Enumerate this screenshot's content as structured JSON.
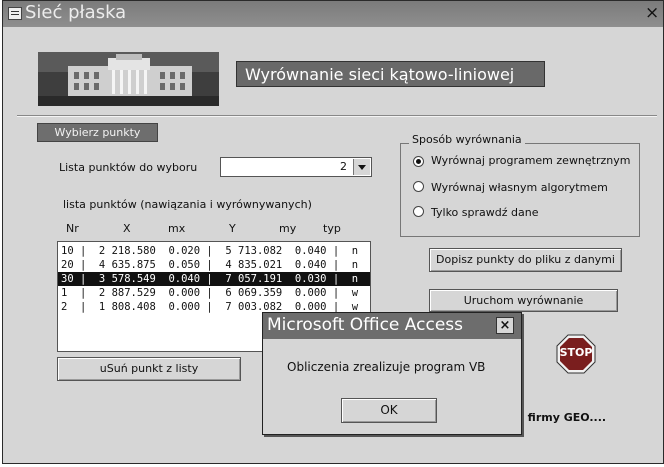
{
  "window": {
    "title": "Sieć płaska",
    "close_glyph": "×",
    "heading": "Wyrównanie sieci kątowo-liniowej"
  },
  "left": {
    "select_button_label": "Wybierz punkty",
    "combo_label": "Lista punktów do wyboru",
    "combo_value": "2",
    "list_caption": "lista punktów (nawiązania i wyrównywanych)",
    "columns": [
      "Nr",
      "X",
      "mx",
      "Y",
      "my",
      "typ"
    ],
    "rows": [
      "10 |  2 218.580  0.020 |  5 713.082  0.040 |  n",
      "20 |  4 635.875  0.050 |  4 835.021  0.040 |  n",
      "30 |  3 578.549  0.040 |  7 057.191  0.030 |  n",
      "1  |  2 887.529  0.000 |  6 069.359  0.000 |  w",
      "2  |  1 808.408  0.000 |  7 003.082  0.000 |  w"
    ],
    "selected_row_index": 2,
    "remove_button_label": "uSuń punkt z listy"
  },
  "right": {
    "group_title": "Sposób wyrównania",
    "options": [
      {
        "label": "Wyrównaj programem zewnętrznym",
        "checked": true
      },
      {
        "label": "Wyrównaj własnym algorytmem",
        "checked": false
      },
      {
        "label": "Tylko sprawdź dane",
        "checked": false
      }
    ],
    "append_button_label": "Dopisz punkty do pliku z danymi",
    "run_button_label": "Uruchom wyrównanie",
    "stop_label": "STOP",
    "footer_text": "h firmy GEO...."
  },
  "dialog": {
    "title": "Microsoft Office Access",
    "close_glyph": "×",
    "message": "Obliczenia zrealizuje program VB",
    "ok_label": "OK"
  },
  "colors": {
    "window_bg": "#d6d6d6",
    "title_bar": "#858585",
    "heading_bg": "#696969",
    "stop_red": "#7a1e1e"
  }
}
